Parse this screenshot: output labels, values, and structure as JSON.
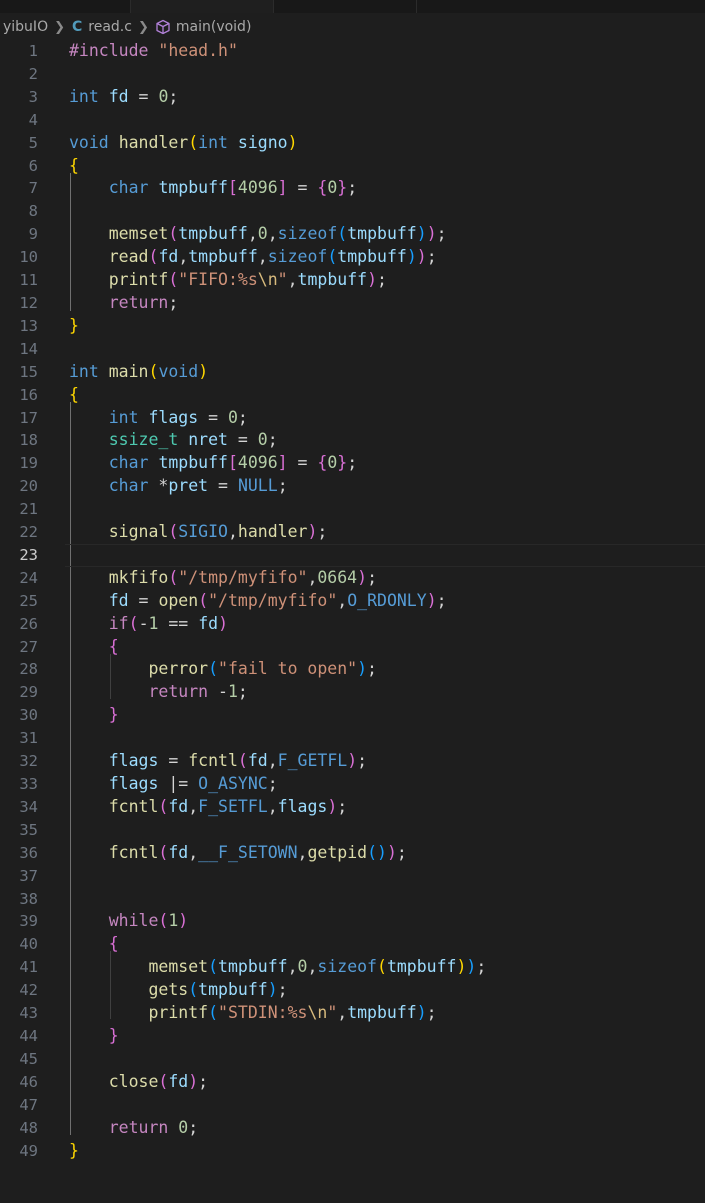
{
  "breadcrumb": {
    "folder": "yibuIO",
    "file": "read.c",
    "symbol": "main(void)",
    "file_icon": "c-language-icon",
    "symbol_icon": "method-cube-icon"
  },
  "editor": {
    "active_line": 23,
    "lines": [
      {
        "n": "1",
        "tokens": [
          [
            "ctl",
            "#include"
          ],
          [
            "",
            " "
          ],
          [
            "str",
            "\"head.h\""
          ]
        ]
      },
      {
        "n": "2",
        "tokens": []
      },
      {
        "n": "3",
        "tokens": [
          [
            "kw",
            "int"
          ],
          [
            "",
            " "
          ],
          [
            "var",
            "fd"
          ],
          [
            "",
            " = "
          ],
          [
            "num",
            "0"
          ],
          [
            "",
            ";"
          ]
        ]
      },
      {
        "n": "4",
        "tokens": []
      },
      {
        "n": "5",
        "tokens": [
          [
            "kw",
            "void"
          ],
          [
            "",
            " "
          ],
          [
            "fn",
            "handler"
          ],
          [
            "b1",
            "("
          ],
          [
            "kw",
            "int"
          ],
          [
            "",
            " "
          ],
          [
            "var",
            "signo"
          ],
          [
            "b1",
            ")"
          ]
        ]
      },
      {
        "n": "6",
        "tokens": [
          [
            "b1",
            "{"
          ]
        ]
      },
      {
        "n": "7",
        "tokens": [
          [
            "",
            "    "
          ],
          [
            "kw",
            "char"
          ],
          [
            "",
            " "
          ],
          [
            "var",
            "tmpbuff"
          ],
          [
            "b2",
            "["
          ],
          [
            "num",
            "4096"
          ],
          [
            "b2",
            "]"
          ],
          [
            "",
            " = "
          ],
          [
            "b2",
            "{"
          ],
          [
            "num",
            "0"
          ],
          [
            "b2",
            "}"
          ],
          [
            "",
            ";"
          ]
        ]
      },
      {
        "n": "8",
        "tokens": []
      },
      {
        "n": "9",
        "tokens": [
          [
            "",
            "    "
          ],
          [
            "fn",
            "memset"
          ],
          [
            "b2",
            "("
          ],
          [
            "var",
            "tmpbuff"
          ],
          [
            "",
            ","
          ],
          [
            "num",
            "0"
          ],
          [
            "",
            ","
          ],
          [
            "kw",
            "sizeof"
          ],
          [
            "b3",
            "("
          ],
          [
            "var",
            "tmpbuff"
          ],
          [
            "b3",
            ")"
          ],
          [
            "b2",
            ")"
          ],
          [
            "",
            ";"
          ]
        ]
      },
      {
        "n": "10",
        "tokens": [
          [
            "",
            "    "
          ],
          [
            "fn",
            "read"
          ],
          [
            "b2",
            "("
          ],
          [
            "var",
            "fd"
          ],
          [
            "",
            ","
          ],
          [
            "var",
            "tmpbuff"
          ],
          [
            "",
            ","
          ],
          [
            "kw",
            "sizeof"
          ],
          [
            "b3",
            "("
          ],
          [
            "var",
            "tmpbuff"
          ],
          [
            "b3",
            ")"
          ],
          [
            "b2",
            ")"
          ],
          [
            "",
            ";"
          ]
        ]
      },
      {
        "n": "11",
        "tokens": [
          [
            "",
            "    "
          ],
          [
            "fn",
            "printf"
          ],
          [
            "b2",
            "("
          ],
          [
            "str",
            "\"FIFO:%s"
          ],
          [
            "esc",
            "\\n"
          ],
          [
            "str",
            "\""
          ],
          [
            "",
            ","
          ],
          [
            "var",
            "tmpbuff"
          ],
          [
            "b2",
            ")"
          ],
          [
            "",
            ";"
          ]
        ]
      },
      {
        "n": "12",
        "tokens": [
          [
            "",
            "    "
          ],
          [
            "ctl",
            "return"
          ],
          [
            "",
            ";"
          ]
        ]
      },
      {
        "n": "13",
        "tokens": [
          [
            "b1",
            "}"
          ]
        ]
      },
      {
        "n": "14",
        "tokens": []
      },
      {
        "n": "15",
        "tokens": [
          [
            "kw",
            "int"
          ],
          [
            "",
            " "
          ],
          [
            "fn",
            "main"
          ],
          [
            "b1",
            "("
          ],
          [
            "kw",
            "void"
          ],
          [
            "b1",
            ")"
          ]
        ]
      },
      {
        "n": "16",
        "tokens": [
          [
            "b1",
            "{"
          ]
        ]
      },
      {
        "n": "17",
        "tokens": [
          [
            "",
            "    "
          ],
          [
            "kw",
            "int"
          ],
          [
            "",
            " "
          ],
          [
            "var",
            "flags"
          ],
          [
            "",
            " = "
          ],
          [
            "num",
            "0"
          ],
          [
            "",
            ";"
          ]
        ]
      },
      {
        "n": "18",
        "tokens": [
          [
            "",
            "    "
          ],
          [
            "typ",
            "ssize_t"
          ],
          [
            "",
            " "
          ],
          [
            "var",
            "nret"
          ],
          [
            "",
            " = "
          ],
          [
            "num",
            "0"
          ],
          [
            "",
            ";"
          ]
        ]
      },
      {
        "n": "19",
        "tokens": [
          [
            "",
            "    "
          ],
          [
            "kw",
            "char"
          ],
          [
            "",
            " "
          ],
          [
            "var",
            "tmpbuff"
          ],
          [
            "b2",
            "["
          ],
          [
            "num",
            "4096"
          ],
          [
            "b2",
            "]"
          ],
          [
            "",
            " = "
          ],
          [
            "b2",
            "{"
          ],
          [
            "num",
            "0"
          ],
          [
            "b2",
            "}"
          ],
          [
            "",
            ";"
          ]
        ]
      },
      {
        "n": "20",
        "tokens": [
          [
            "",
            "    "
          ],
          [
            "kw",
            "char"
          ],
          [
            "",
            " *"
          ],
          [
            "var",
            "pret"
          ],
          [
            "",
            " = "
          ],
          [
            "mac",
            "NULL"
          ],
          [
            "",
            ";"
          ]
        ]
      },
      {
        "n": "21",
        "tokens": []
      },
      {
        "n": "22",
        "tokens": [
          [
            "",
            "    "
          ],
          [
            "fn",
            "signal"
          ],
          [
            "b2",
            "("
          ],
          [
            "mac",
            "SIGIO"
          ],
          [
            "",
            ","
          ],
          [
            "fn",
            "handler"
          ],
          [
            "b2",
            ")"
          ],
          [
            "",
            ";"
          ]
        ]
      },
      {
        "n": "23",
        "tokens": []
      },
      {
        "n": "24",
        "tokens": [
          [
            "",
            "    "
          ],
          [
            "fn",
            "mkfifo"
          ],
          [
            "b2",
            "("
          ],
          [
            "str",
            "\"/tmp/myfifo\""
          ],
          [
            "",
            ","
          ],
          [
            "num",
            "0664"
          ],
          [
            "b2",
            ")"
          ],
          [
            "",
            ";"
          ]
        ]
      },
      {
        "n": "25",
        "tokens": [
          [
            "",
            "    "
          ],
          [
            "var",
            "fd"
          ],
          [
            "",
            " = "
          ],
          [
            "fn",
            "open"
          ],
          [
            "b2",
            "("
          ],
          [
            "str",
            "\"/tmp/myfifo\""
          ],
          [
            "",
            ","
          ],
          [
            "mac",
            "O_RDONLY"
          ],
          [
            "b2",
            ")"
          ],
          [
            "",
            ";"
          ]
        ]
      },
      {
        "n": "26",
        "tokens": [
          [
            "",
            "    "
          ],
          [
            "ctl",
            "if"
          ],
          [
            "b2",
            "("
          ],
          [
            "",
            "-"
          ],
          [
            "num",
            "1"
          ],
          [
            "",
            " == "
          ],
          [
            "var",
            "fd"
          ],
          [
            "b2",
            ")"
          ]
        ]
      },
      {
        "n": "27",
        "tokens": [
          [
            "",
            "    "
          ],
          [
            "b2",
            "{"
          ]
        ]
      },
      {
        "n": "28",
        "tokens": [
          [
            "",
            "        "
          ],
          [
            "fn",
            "perror"
          ],
          [
            "b3",
            "("
          ],
          [
            "str",
            "\"fail to open\""
          ],
          [
            "b3",
            ")"
          ],
          [
            "",
            ";"
          ]
        ]
      },
      {
        "n": "29",
        "tokens": [
          [
            "",
            "        "
          ],
          [
            "ctl",
            "return"
          ],
          [
            "",
            " -"
          ],
          [
            "num",
            "1"
          ],
          [
            "",
            ";"
          ]
        ]
      },
      {
        "n": "30",
        "tokens": [
          [
            "",
            "    "
          ],
          [
            "b2",
            "}"
          ]
        ]
      },
      {
        "n": "31",
        "tokens": []
      },
      {
        "n": "32",
        "tokens": [
          [
            "",
            "    "
          ],
          [
            "var",
            "flags"
          ],
          [
            "",
            " = "
          ],
          [
            "fn",
            "fcntl"
          ],
          [
            "b2",
            "("
          ],
          [
            "var",
            "fd"
          ],
          [
            "",
            ","
          ],
          [
            "mac",
            "F_GETFL"
          ],
          [
            "b2",
            ")"
          ],
          [
            "",
            ";"
          ]
        ]
      },
      {
        "n": "33",
        "tokens": [
          [
            "",
            "    "
          ],
          [
            "var",
            "flags"
          ],
          [
            "",
            " |= "
          ],
          [
            "mac",
            "O_ASYNC"
          ],
          [
            "",
            ";"
          ]
        ]
      },
      {
        "n": "34",
        "tokens": [
          [
            "",
            "    "
          ],
          [
            "fn",
            "fcntl"
          ],
          [
            "b2",
            "("
          ],
          [
            "var",
            "fd"
          ],
          [
            "",
            ","
          ],
          [
            "mac",
            "F_SETFL"
          ],
          [
            "",
            ","
          ],
          [
            "var",
            "flags"
          ],
          [
            "b2",
            ")"
          ],
          [
            "",
            ";"
          ]
        ]
      },
      {
        "n": "35",
        "tokens": []
      },
      {
        "n": "36",
        "tokens": [
          [
            "",
            "    "
          ],
          [
            "fn",
            "fcntl"
          ],
          [
            "b2",
            "("
          ],
          [
            "var",
            "fd"
          ],
          [
            "",
            ","
          ],
          [
            "mac",
            "__F_SETOWN"
          ],
          [
            "",
            ","
          ],
          [
            "fn",
            "getpid"
          ],
          [
            "b3",
            "()"
          ],
          [
            "b2",
            ")"
          ],
          [
            "",
            ";"
          ]
        ]
      },
      {
        "n": "37",
        "tokens": []
      },
      {
        "n": "38",
        "tokens": []
      },
      {
        "n": "39",
        "tokens": [
          [
            "",
            "    "
          ],
          [
            "ctl",
            "while"
          ],
          [
            "b2",
            "("
          ],
          [
            "num",
            "1"
          ],
          [
            "b2",
            ")"
          ]
        ]
      },
      {
        "n": "40",
        "tokens": [
          [
            "",
            "    "
          ],
          [
            "b2",
            "{"
          ]
        ]
      },
      {
        "n": "41",
        "tokens": [
          [
            "",
            "        "
          ],
          [
            "fn",
            "memset"
          ],
          [
            "b3",
            "("
          ],
          [
            "var",
            "tmpbuff"
          ],
          [
            "",
            ","
          ],
          [
            "num",
            "0"
          ],
          [
            "",
            ","
          ],
          [
            "kw",
            "sizeof"
          ],
          [
            "b1",
            "("
          ],
          [
            "var",
            "tmpbuff"
          ],
          [
            "b1",
            ")"
          ],
          [
            "b3",
            ")"
          ],
          [
            "",
            ";"
          ]
        ]
      },
      {
        "n": "42",
        "tokens": [
          [
            "",
            "        "
          ],
          [
            "fn",
            "gets"
          ],
          [
            "b3",
            "("
          ],
          [
            "var",
            "tmpbuff"
          ],
          [
            "b3",
            ")"
          ],
          [
            "",
            ";"
          ]
        ]
      },
      {
        "n": "43",
        "tokens": [
          [
            "",
            "        "
          ],
          [
            "fn",
            "printf"
          ],
          [
            "b3",
            "("
          ],
          [
            "str",
            "\"STDIN:%s"
          ],
          [
            "esc",
            "\\n"
          ],
          [
            "str",
            "\""
          ],
          [
            "",
            ","
          ],
          [
            "var",
            "tmpbuff"
          ],
          [
            "b3",
            ")"
          ],
          [
            "",
            ";"
          ]
        ]
      },
      {
        "n": "44",
        "tokens": [
          [
            "",
            "    "
          ],
          [
            "b2",
            "}"
          ]
        ]
      },
      {
        "n": "45",
        "tokens": []
      },
      {
        "n": "46",
        "tokens": [
          [
            "",
            "    "
          ],
          [
            "fn",
            "close"
          ],
          [
            "b2",
            "("
          ],
          [
            "var",
            "fd"
          ],
          [
            "b2",
            ")"
          ],
          [
            "",
            ";"
          ]
        ]
      },
      {
        "n": "47",
        "tokens": []
      },
      {
        "n": "48",
        "tokens": [
          [
            "",
            "    "
          ],
          [
            "ctl",
            "return"
          ],
          [
            "",
            " "
          ],
          [
            "num",
            "0"
          ],
          [
            "",
            ";"
          ]
        ]
      },
      {
        "n": "49",
        "tokens": [
          [
            "b1",
            "}"
          ]
        ]
      }
    ]
  }
}
